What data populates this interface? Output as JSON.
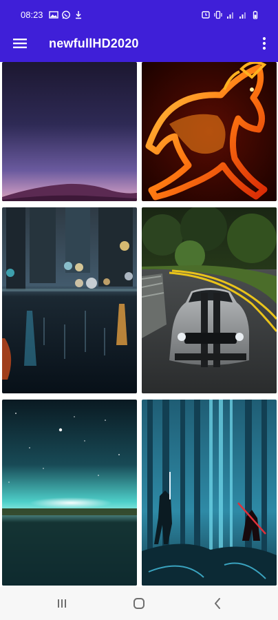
{
  "status_bar": {
    "time": "08:23",
    "left_icons": [
      "image-icon",
      "whatsapp-icon",
      "download-icon"
    ],
    "right_icons": [
      "alarm-icon",
      "vibrate-icon",
      "signal-icon",
      "signal-icon",
      "battery-icon"
    ]
  },
  "app_bar": {
    "title": "newfullHD2020",
    "menu_icon": "hamburger-menu-icon",
    "overflow_icon": "more-vert-icon"
  },
  "wallpapers": [
    {
      "id": 1,
      "subject": "purple desert dune at dusk"
    },
    {
      "id": 2,
      "subject": "horse made of fire"
    },
    {
      "id": 3,
      "subject": "rainy city street with bokeh lights"
    },
    {
      "id": 4,
      "subject": "grey muscle car on a forest road"
    },
    {
      "id": 5,
      "subject": "starry sky over teal horizon"
    },
    {
      "id": 6,
      "subject": "blue forest with lightsaber figures"
    }
  ],
  "nav_bar": {
    "icons": [
      "recent-apps-icon",
      "home-icon",
      "back-icon"
    ]
  },
  "colors": {
    "primary": "#3f1fd8",
    "nav_background": "#f7f7f7",
    "background": "#ffffff"
  }
}
